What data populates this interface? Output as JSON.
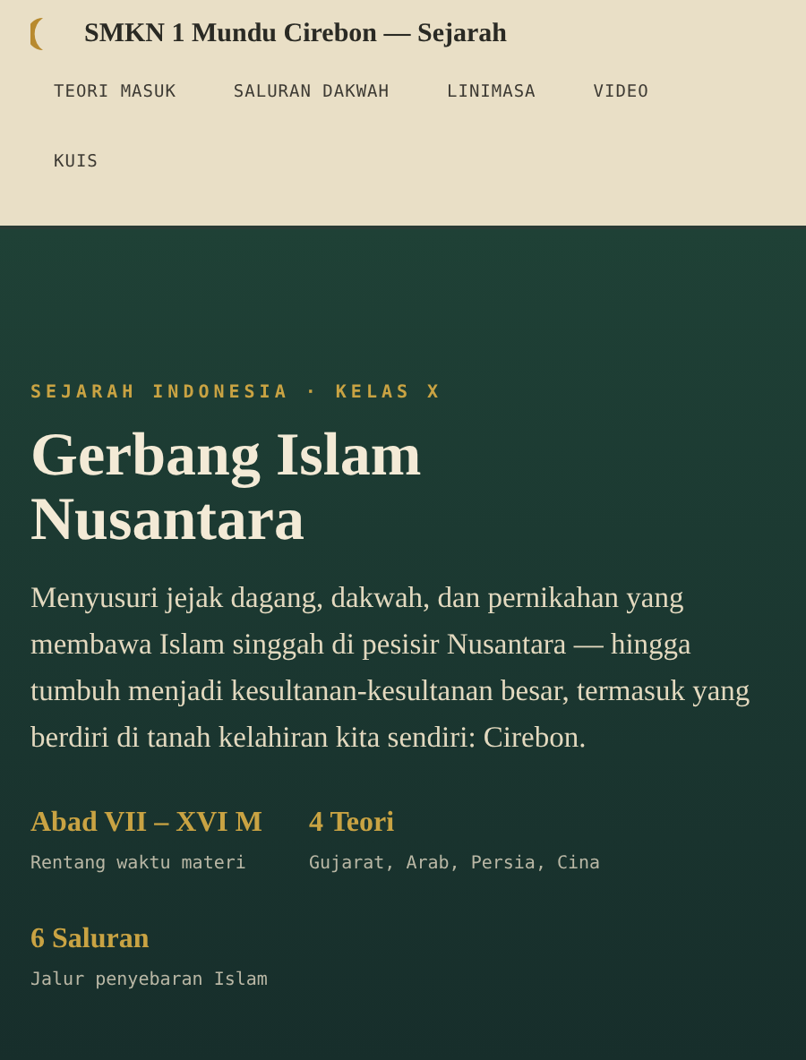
{
  "header": {
    "title": "SMKN 1 Mundu Cirebon — Sejarah",
    "nav": [
      "TEORI MASUK",
      "SALURAN DAKWAH",
      "LINIMASA",
      "VIDEO",
      "KUIS"
    ]
  },
  "hero": {
    "eyebrow": "SEJARAH INDONESIA · KELAS X",
    "title": "Gerbang Islam Nusantara",
    "lead": "Menyusuri jejak dagang, dakwah, dan pernikahan yang membawa Islam singgah di pesisir Nusantara — hingga tumbuh menjadi kesultanan-kesultanan besar, termasuk yang berdiri di tanah kelahiran kita sendiri: Cirebon.",
    "stats": [
      {
        "value": "Abad VII – XVI M",
        "label": "Rentang waktu materi"
      },
      {
        "value": "4 Teori",
        "label": "Gujarat, Arab, Persia, Cina"
      },
      {
        "value": "6 Saluran",
        "label": "Jalur penyebaran Islam"
      }
    ]
  }
}
